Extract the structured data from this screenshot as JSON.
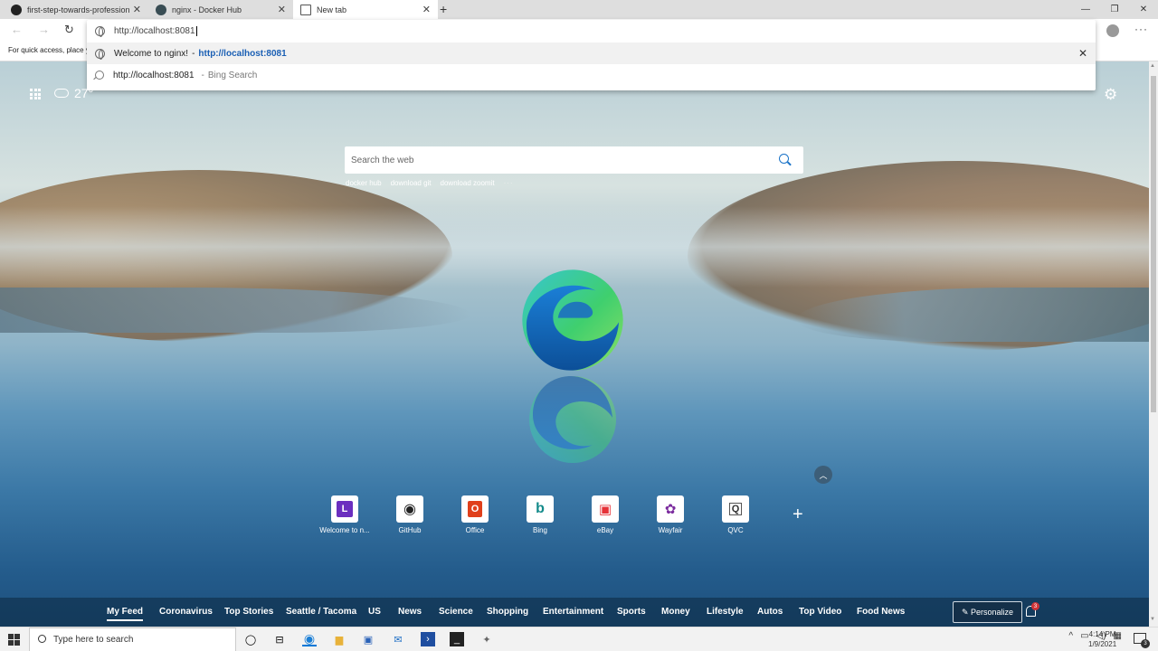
{
  "tabs": [
    {
      "label": "first-step-towards-professional-",
      "icon": "github-icon",
      "active": false
    },
    {
      "label": "nginx - Docker Hub",
      "icon": "docker-icon",
      "active": false
    },
    {
      "label": "New tab",
      "icon": "newtab-icon",
      "active": true
    }
  ],
  "favorites_bar": {
    "text": "For quick access, place y"
  },
  "address": {
    "value": "http://localhost:8081",
    "suggestions": [
      {
        "title": "Welcome to nginx!",
        "separator": "-",
        "url": "http://localhost:8081"
      },
      {
        "url": "http://localhost:8081",
        "separator": "-",
        "sub": "Bing Search"
      }
    ]
  },
  "weather": {
    "temp": "27°"
  },
  "search": {
    "placeholder": "Search the web",
    "recent": [
      "docker hub",
      "download git",
      "download zoomit"
    ],
    "more": "···"
  },
  "quick_links": [
    {
      "name": "Welcome to n...",
      "glyph": "L",
      "color": "#6b2fbf",
      "text_color": "#ffffff"
    },
    {
      "name": "GitHub",
      "glyph": "◉",
      "color": "#ffffff",
      "text_color": "#222222"
    },
    {
      "name": "Office",
      "glyph": "O",
      "color": "#e0401b",
      "text_color": "#ffffff"
    },
    {
      "name": "Bing",
      "glyph": "b",
      "color": "#ffffff",
      "text_color": "#138a8a"
    },
    {
      "name": "eBay",
      "glyph": "▣",
      "color": "#ffffff",
      "text_color": "#e53238"
    },
    {
      "name": "Wayfair",
      "glyph": "✿",
      "color": "#ffffff",
      "text_color": "#7b2b9e"
    },
    {
      "name": "QVC",
      "glyph": "Q",
      "color": "#ffffff",
      "text_color": "#333333"
    }
  ],
  "feed_nav": [
    "My Feed",
    "Coronavirus",
    "Top Stories",
    "Seattle / Tacoma",
    "US",
    "News",
    "Science",
    "Shopping",
    "Entertainment",
    "Sports",
    "Money",
    "Lifestyle",
    "Autos",
    "Top Video",
    "Food News"
  ],
  "personalize": {
    "label": "✎ Personalize"
  },
  "notifications": {
    "count": "3"
  },
  "taskbar": {
    "search_placeholder": "Type here to search",
    "time": "4:14 PM",
    "date": "1/9/2021",
    "action_center_count": "3"
  },
  "colors": {
    "accent": "#1a5fb4",
    "edge_blue": "#0c59a4",
    "edge_green": "#3fcf6e"
  }
}
